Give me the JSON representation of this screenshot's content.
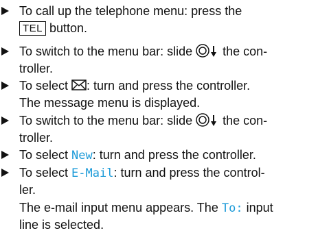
{
  "steps": [
    {
      "lines": [
        {
          "a": "To call up the telephone menu: press the"
        },
        {
          "key": "TEL",
          "a": " button."
        }
      ]
    },
    {
      "lines": [
        {
          "a": "To switch to the menu bar: slide ",
          "icon": "controller-slide-down-icon",
          "b": " the con-"
        },
        {
          "a": "troller."
        }
      ]
    },
    {
      "lines": [
        {
          "a": "To select ",
          "icon": "envelope-icon",
          "b": ": turn and press the controller."
        },
        {
          "a": "The message menu is displayed."
        }
      ]
    },
    {
      "lines": [
        {
          "a": "To switch to the menu bar: slide ",
          "icon": "controller-slide-down-icon",
          "b": " the con-"
        },
        {
          "a": "troller."
        }
      ]
    },
    {
      "lines": [
        {
          "a": "To select ",
          "kw": "New",
          "b": ": turn and press the controller."
        }
      ]
    },
    {
      "lines": [
        {
          "a": "To select ",
          "kw": "E-Mail",
          "b": ": turn and press the control-"
        },
        {
          "a": "ler."
        },
        {
          "a": "The e-mail input menu appears. The ",
          "kw": "To:",
          "b": " input"
        },
        {
          "a": "line is selected."
        }
      ]
    }
  ],
  "colors": {
    "keyword": "#1b9ad8",
    "text": "#111111"
  }
}
